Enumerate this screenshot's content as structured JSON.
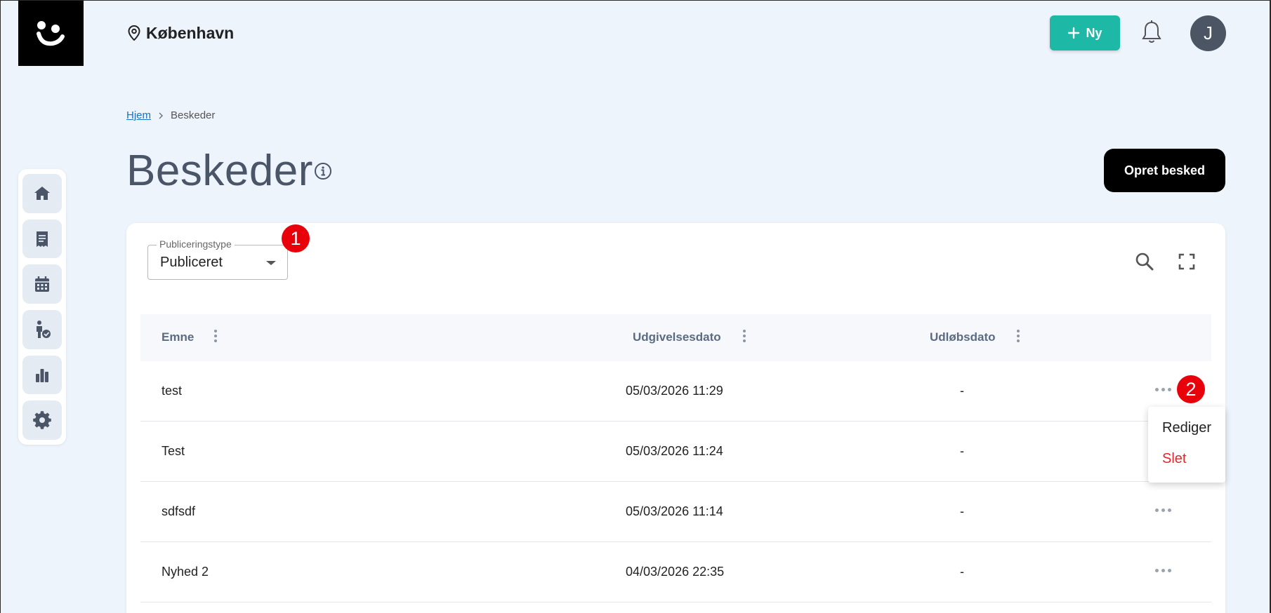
{
  "header": {
    "location": "København",
    "new_button": "Ny",
    "avatar_initial": "J"
  },
  "breadcrumb": {
    "home": "Hjem",
    "current": "Beskeder"
  },
  "page": {
    "title": "Beskeder",
    "create_button": "Opret besked"
  },
  "filter": {
    "label": "Publiceringstype",
    "value": "Publiceret"
  },
  "badges": [
    "1",
    "2"
  ],
  "table": {
    "columns": [
      "Emne",
      "Udgivelsesdato",
      "Udløbsdato"
    ],
    "rows": [
      {
        "subject": "test",
        "published": "05/03/2026 11:29",
        "expires": "-"
      },
      {
        "subject": "Test",
        "published": "05/03/2026 11:24",
        "expires": "-"
      },
      {
        "subject": "sdfsdf",
        "published": "05/03/2026 11:14",
        "expires": "-"
      },
      {
        "subject": "Nyhed 2",
        "published": "04/03/2026 22:35",
        "expires": "-"
      }
    ]
  },
  "row_menu": {
    "edit": "Rediger",
    "delete": "Slet"
  },
  "sidebar": {
    "items": [
      "home-icon",
      "receipt-icon",
      "calendar-icon",
      "person-check-icon",
      "bar-chart-icon",
      "gear-icon"
    ]
  },
  "colors": {
    "accent": "#1eb8a6",
    "background": "#eef4fc",
    "badge": "#e8000b",
    "danger": "#e0282e"
  }
}
